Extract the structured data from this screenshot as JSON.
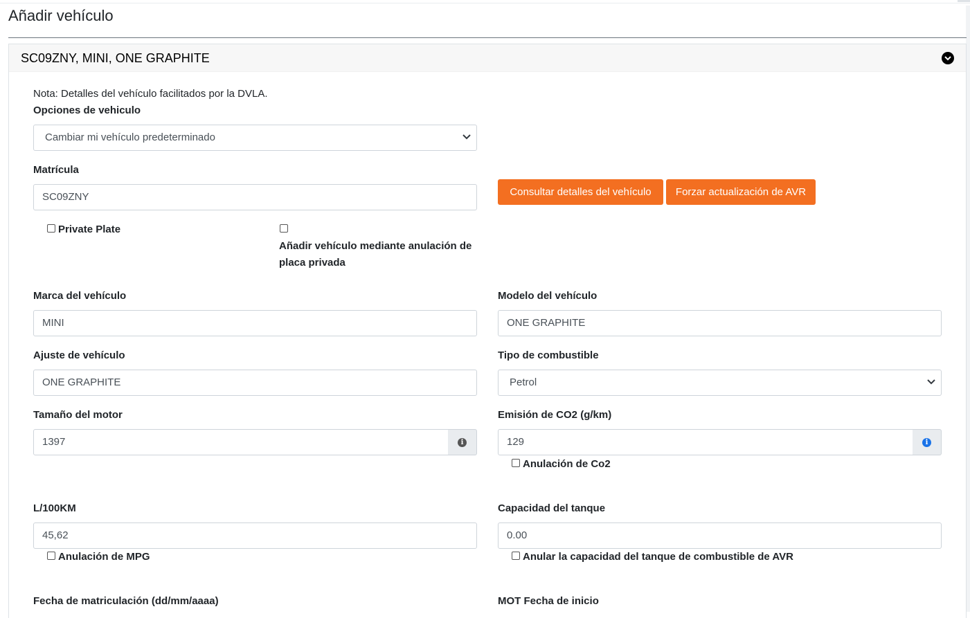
{
  "page": {
    "title": "Añadir vehículo"
  },
  "card": {
    "title": "SC09ZNY, MINI, ONE GRAPHITE"
  },
  "form": {
    "note": "Nota: Detalles del vehículo facilitados por la DVLA.",
    "vehicle_options": {
      "label": "Opciones de vehiculo",
      "value": "Cambiar mi vehículo predeterminado"
    },
    "registration": {
      "label": "Matrícula",
      "value": "SC09ZNY"
    },
    "buttons": {
      "lookup": "Consultar detalles del vehículo",
      "force_avr": "Forzar actualización de AVR"
    },
    "private_plate": {
      "label": "Private Plate",
      "checked": false
    },
    "private_plate_override": {
      "label_line1": "Añadir vehículo mediante anulación de",
      "label_line2": "placa privada",
      "checked": false
    },
    "make": {
      "label": "Marca del vehículo",
      "value": "MINI"
    },
    "model": {
      "label": "Modelo del vehículo",
      "value": "ONE GRAPHITE"
    },
    "trim": {
      "label": "Ajuste de vehículo",
      "value": "ONE GRAPHITE"
    },
    "fuel_type": {
      "label": "Tipo de combustible",
      "value": "Petrol"
    },
    "engine_size": {
      "label": "Tamaño del motor",
      "value": "1397"
    },
    "co2": {
      "label": "Emisión de CO2 (g/km)",
      "value": "129",
      "override_label": "Anulación de Co2"
    },
    "consumption": {
      "label": "L/100KM",
      "value": "45,62",
      "override_label": "Anulación de MPG"
    },
    "tank": {
      "label": "Capacidad del tanque",
      "value": "0.00",
      "override_label": "Anular la capacidad del tanque de combustible de AVR"
    },
    "registration_date": {
      "label": "Fecha de matriculación (dd/mm/aaaa)"
    },
    "mot_start": {
      "label": "MOT Fecha de inicio"
    }
  },
  "colors": {
    "accent": "#f36f21",
    "info_blue": "#1a73e8",
    "info_grey": "#555555"
  },
  "icons": {
    "collapse": "chevron-down-circle-icon",
    "info": "info-circle-icon",
    "select": "chevron-down-icon"
  }
}
